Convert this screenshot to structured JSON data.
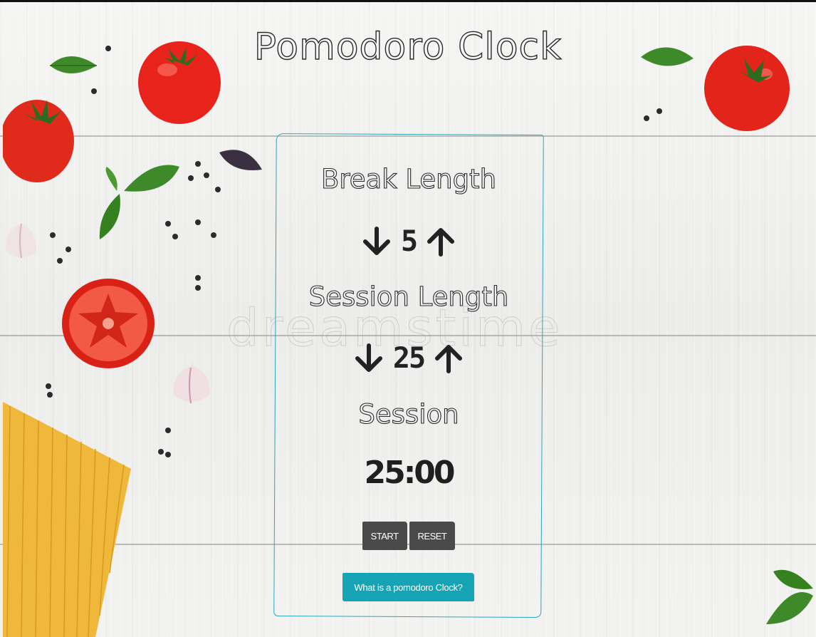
{
  "app": {
    "title": "Pomodoro Clock",
    "watermark": "dreamstime"
  },
  "break": {
    "label": "Break Length",
    "value": "5",
    "decrement_icon": "arrow-down-icon",
    "increment_icon": "arrow-up-icon"
  },
  "session": {
    "label": "Session Length",
    "value": "25",
    "decrement_icon": "arrow-down-icon",
    "increment_icon": "arrow-up-icon"
  },
  "timer": {
    "mode_label": "Session",
    "display": "25:00"
  },
  "controls": {
    "start_label": "START",
    "reset_label": "RESET",
    "info_label": "What is a pomodoro Clock?"
  },
  "colors": {
    "accent": "#15a4b6",
    "card_border": "#2ca7b8",
    "button": "#4a4a4a",
    "tomato": "#e8231b",
    "basil": "#3e8a2a",
    "pasta": "#f0b83a"
  }
}
